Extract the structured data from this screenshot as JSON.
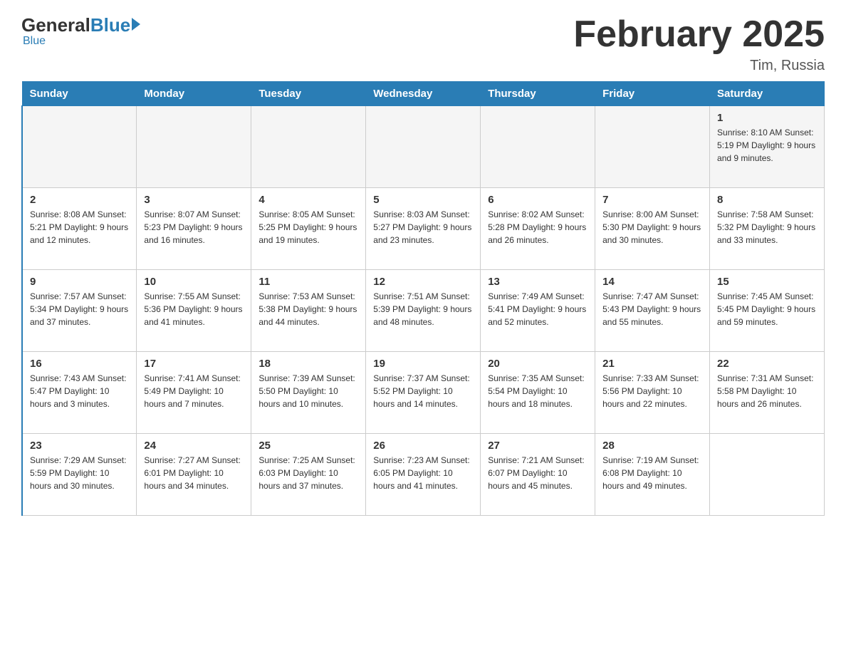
{
  "logo": {
    "text_black": "General",
    "text_blue": "Blue"
  },
  "title": "February 2025",
  "subtitle": "Tim, Russia",
  "days_of_week": [
    "Sunday",
    "Monday",
    "Tuesday",
    "Wednesday",
    "Thursday",
    "Friday",
    "Saturday"
  ],
  "weeks": [
    [
      {
        "day": "",
        "info": ""
      },
      {
        "day": "",
        "info": ""
      },
      {
        "day": "",
        "info": ""
      },
      {
        "day": "",
        "info": ""
      },
      {
        "day": "",
        "info": ""
      },
      {
        "day": "",
        "info": ""
      },
      {
        "day": "1",
        "info": "Sunrise: 8:10 AM\nSunset: 5:19 PM\nDaylight: 9 hours and 9 minutes."
      }
    ],
    [
      {
        "day": "2",
        "info": "Sunrise: 8:08 AM\nSunset: 5:21 PM\nDaylight: 9 hours and 12 minutes."
      },
      {
        "day": "3",
        "info": "Sunrise: 8:07 AM\nSunset: 5:23 PM\nDaylight: 9 hours and 16 minutes."
      },
      {
        "day": "4",
        "info": "Sunrise: 8:05 AM\nSunset: 5:25 PM\nDaylight: 9 hours and 19 minutes."
      },
      {
        "day": "5",
        "info": "Sunrise: 8:03 AM\nSunset: 5:27 PM\nDaylight: 9 hours and 23 minutes."
      },
      {
        "day": "6",
        "info": "Sunrise: 8:02 AM\nSunset: 5:28 PM\nDaylight: 9 hours and 26 minutes."
      },
      {
        "day": "7",
        "info": "Sunrise: 8:00 AM\nSunset: 5:30 PM\nDaylight: 9 hours and 30 minutes."
      },
      {
        "day": "8",
        "info": "Sunrise: 7:58 AM\nSunset: 5:32 PM\nDaylight: 9 hours and 33 minutes."
      }
    ],
    [
      {
        "day": "9",
        "info": "Sunrise: 7:57 AM\nSunset: 5:34 PM\nDaylight: 9 hours and 37 minutes."
      },
      {
        "day": "10",
        "info": "Sunrise: 7:55 AM\nSunset: 5:36 PM\nDaylight: 9 hours and 41 minutes."
      },
      {
        "day": "11",
        "info": "Sunrise: 7:53 AM\nSunset: 5:38 PM\nDaylight: 9 hours and 44 minutes."
      },
      {
        "day": "12",
        "info": "Sunrise: 7:51 AM\nSunset: 5:39 PM\nDaylight: 9 hours and 48 minutes."
      },
      {
        "day": "13",
        "info": "Sunrise: 7:49 AM\nSunset: 5:41 PM\nDaylight: 9 hours and 52 minutes."
      },
      {
        "day": "14",
        "info": "Sunrise: 7:47 AM\nSunset: 5:43 PM\nDaylight: 9 hours and 55 minutes."
      },
      {
        "day": "15",
        "info": "Sunrise: 7:45 AM\nSunset: 5:45 PM\nDaylight: 9 hours and 59 minutes."
      }
    ],
    [
      {
        "day": "16",
        "info": "Sunrise: 7:43 AM\nSunset: 5:47 PM\nDaylight: 10 hours and 3 minutes."
      },
      {
        "day": "17",
        "info": "Sunrise: 7:41 AM\nSunset: 5:49 PM\nDaylight: 10 hours and 7 minutes."
      },
      {
        "day": "18",
        "info": "Sunrise: 7:39 AM\nSunset: 5:50 PM\nDaylight: 10 hours and 10 minutes."
      },
      {
        "day": "19",
        "info": "Sunrise: 7:37 AM\nSunset: 5:52 PM\nDaylight: 10 hours and 14 minutes."
      },
      {
        "day": "20",
        "info": "Sunrise: 7:35 AM\nSunset: 5:54 PM\nDaylight: 10 hours and 18 minutes."
      },
      {
        "day": "21",
        "info": "Sunrise: 7:33 AM\nSunset: 5:56 PM\nDaylight: 10 hours and 22 minutes."
      },
      {
        "day": "22",
        "info": "Sunrise: 7:31 AM\nSunset: 5:58 PM\nDaylight: 10 hours and 26 minutes."
      }
    ],
    [
      {
        "day": "23",
        "info": "Sunrise: 7:29 AM\nSunset: 5:59 PM\nDaylight: 10 hours and 30 minutes."
      },
      {
        "day": "24",
        "info": "Sunrise: 7:27 AM\nSunset: 6:01 PM\nDaylight: 10 hours and 34 minutes."
      },
      {
        "day": "25",
        "info": "Sunrise: 7:25 AM\nSunset: 6:03 PM\nDaylight: 10 hours and 37 minutes."
      },
      {
        "day": "26",
        "info": "Sunrise: 7:23 AM\nSunset: 6:05 PM\nDaylight: 10 hours and 41 minutes."
      },
      {
        "day": "27",
        "info": "Sunrise: 7:21 AM\nSunset: 6:07 PM\nDaylight: 10 hours and 45 minutes."
      },
      {
        "day": "28",
        "info": "Sunrise: 7:19 AM\nSunset: 6:08 PM\nDaylight: 10 hours and 49 minutes."
      },
      {
        "day": "",
        "info": ""
      }
    ]
  ]
}
